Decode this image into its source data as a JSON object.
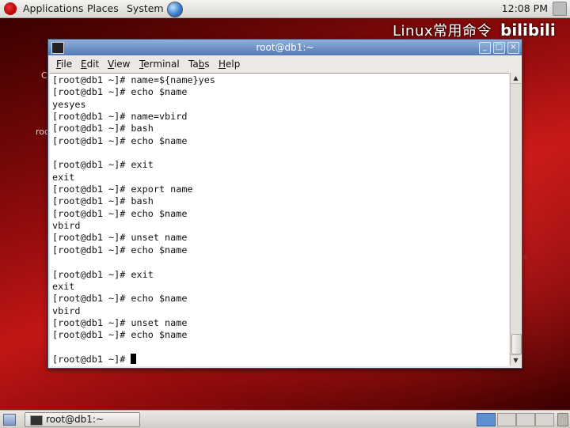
{
  "top_panel": {
    "menus": [
      "Applications",
      "Places",
      "System"
    ],
    "clock": "12:08 PM"
  },
  "overlay": {
    "title": "Linux常用命令",
    "logo": "bilibili"
  },
  "desktop": {
    "glyphs": [
      "C",
      "roo"
    ]
  },
  "window": {
    "title": "root@db1:~",
    "menus": [
      {
        "label": "File",
        "mnemonic": "F",
        "rest": "ile"
      },
      {
        "label": "Edit",
        "mnemonic": "E",
        "rest": "dit"
      },
      {
        "label": "View",
        "mnemonic": "V",
        "rest": "iew"
      },
      {
        "label": "Terminal",
        "mnemonic": "T",
        "rest": "erminal"
      },
      {
        "label": "Tabs",
        "mnemonic": "b",
        "pre": "Ta",
        "rest": "s"
      },
      {
        "label": "Help",
        "mnemonic": "H",
        "rest": "elp"
      }
    ],
    "controls": {
      "minimize": "_",
      "maximize": "□",
      "close": "×"
    }
  },
  "terminal": {
    "lines": [
      "[root@db1 ~]# name=${name}yes",
      "[root@db1 ~]# echo $name",
      "yesyes",
      "[root@db1 ~]# name=vbird",
      "[root@db1 ~]# bash",
      "[root@db1 ~]# echo $name",
      "",
      "[root@db1 ~]# exit",
      "exit",
      "[root@db1 ~]# export name",
      "[root@db1 ~]# bash",
      "[root@db1 ~]# echo $name",
      "vbird",
      "[root@db1 ~]# unset name",
      "[root@db1 ~]# echo $name",
      "",
      "[root@db1 ~]# exit",
      "exit",
      "[root@db1 ~]# echo $name",
      "vbird",
      "[root@db1 ~]# unset name",
      "[root@db1 ~]# echo $name",
      ""
    ],
    "prompt": "[root@db1 ~]# "
  },
  "bottom_panel": {
    "task_label": "root@db1:~"
  },
  "icons": {
    "fedora": "fedora-logo-icon",
    "network": "globe-icon",
    "terminal": "terminal-icon",
    "show_desktop": "show-desktop-icon",
    "trash": "trash-icon"
  }
}
